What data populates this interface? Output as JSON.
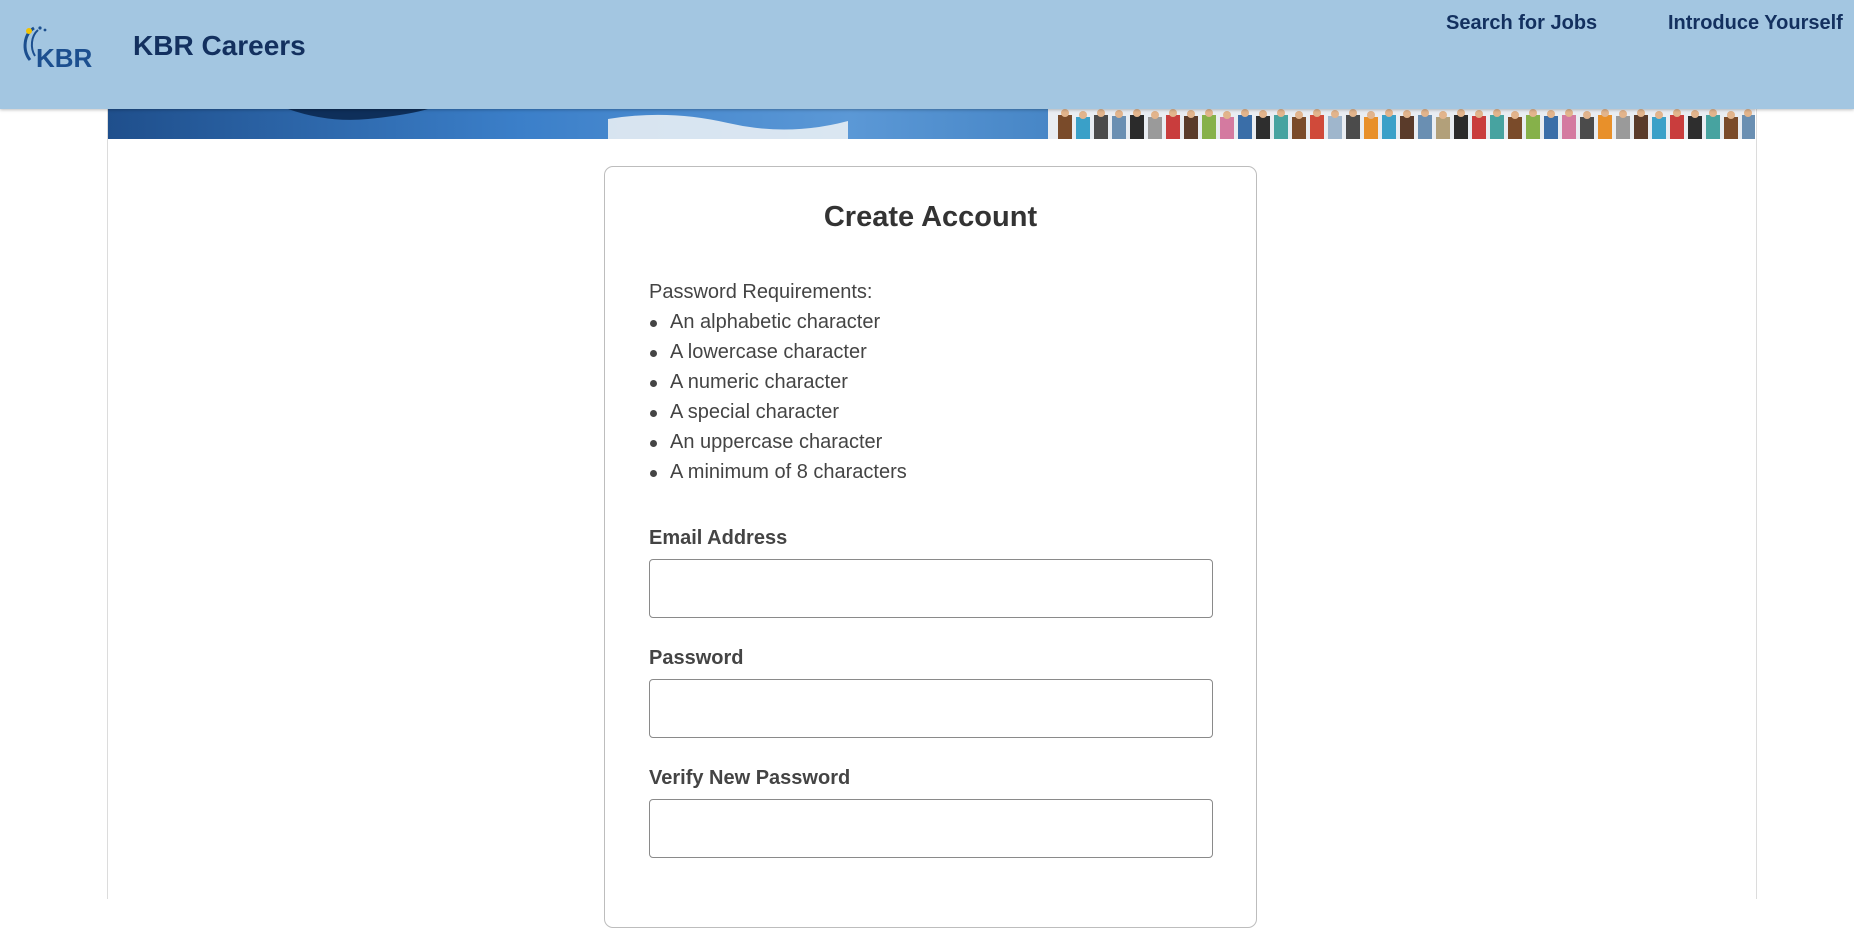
{
  "header": {
    "brand_title": "KBR Careers",
    "logo_text": "KBR",
    "nav": {
      "search_jobs": "Search for Jobs",
      "introduce_yourself": "Introduce Yourself"
    }
  },
  "form": {
    "title": "Create Account",
    "requirements_heading": "Password Requirements:",
    "requirements": [
      "An alphabetic character",
      "A lowercase character",
      "A numeric character",
      "A special character",
      "An uppercase character",
      "A minimum of 8 characters"
    ],
    "email": {
      "label": "Email Address",
      "value": "",
      "placeholder": ""
    },
    "password": {
      "label": "Password",
      "value": "",
      "placeholder": ""
    },
    "verify_password": {
      "label": "Verify New Password",
      "value": "",
      "placeholder": ""
    }
  },
  "colors": {
    "header_bg": "#a3c6e1",
    "brand_navy": "#13305f",
    "banner_blue": "#2f6db5"
  }
}
